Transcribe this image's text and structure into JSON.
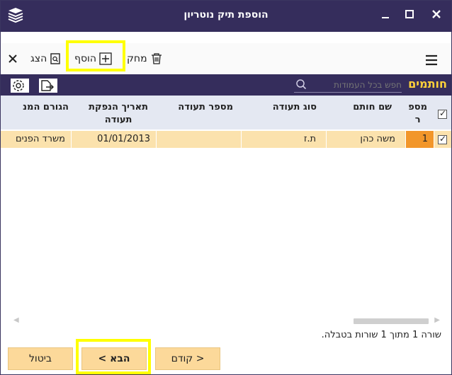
{
  "window": {
    "title": "הוספת תיק נוטריון",
    "buttons": [
      "close-icon",
      "maximize-icon",
      "minimize-icon"
    ]
  },
  "toolbar": {
    "view_label": "הצג",
    "add_label": "הוסף",
    "delete_label": "מחק"
  },
  "section": {
    "title": "חותמים",
    "search_placeholder": "חפש בכל העמודות"
  },
  "table": {
    "columns": [
      "מספ ר",
      "שם חותם",
      "סוג תעודה",
      "מספר תעודה",
      "תאריך הנפקת תעודה",
      "הגורם המנפיק"
    ],
    "col_num_line1": "מספ",
    "col_num_line2": "ר",
    "col_name": "שם חותם",
    "col_doc_type": "סוג תעודה",
    "col_doc_number": "מספר תעודה",
    "col_date_line1": "תאריך הנפקת",
    "col_date_line2": "תעודה",
    "col_issuer": "הגורם המנ",
    "rows": [
      {
        "num": "1",
        "name": "משה כהן",
        "doc_type": "ת.ז",
        "doc_number": "",
        "date": "01/01/2013",
        "issuer": "משרד הפנים"
      }
    ]
  },
  "status_text": "שורה 1 מתוך 1 שורות בטבלה.",
  "footer": {
    "cancel_label": "ביטול",
    "next_label": "הבא >",
    "prev_label": "< קודם"
  },
  "colors": {
    "titlebar": "#352d5c",
    "accent": "#ffd23a",
    "row_highlight": "#fbe2ad",
    "button": "#fcd99a",
    "focus_highlight": "#ffff00"
  }
}
